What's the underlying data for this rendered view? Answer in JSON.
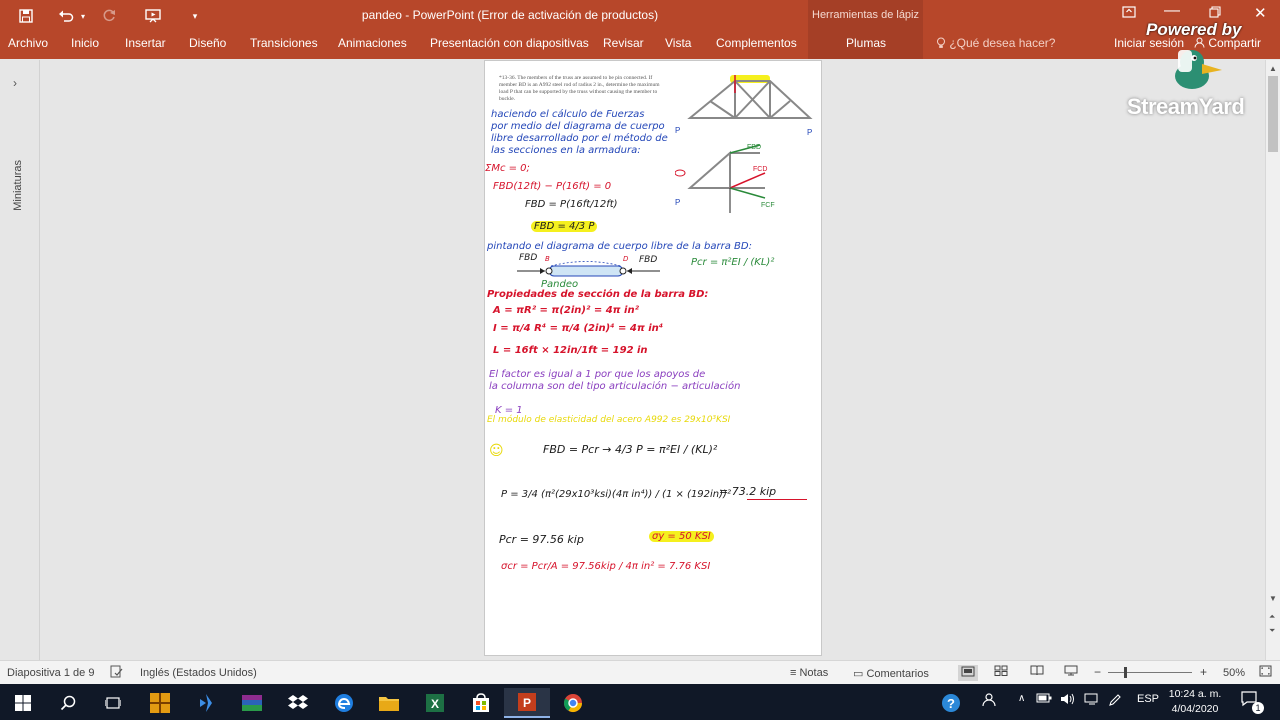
{
  "app": {
    "window_title": "pandeo - PowerPoint (Error de activación de productos)",
    "contextual_group": "Herramientas de lápiz"
  },
  "ribbon": {
    "tabs": [
      "Archivo",
      "Inicio",
      "Insertar",
      "Diseño",
      "Transiciones",
      "Animaciones",
      "Presentación con diapositivas",
      "Revisar",
      "Vista",
      "Complementos",
      "Plumas"
    ],
    "tell_me": "¿Qué desea hacer?",
    "sign_in": "Iniciar sesión",
    "share": "Compartir"
  },
  "thumbnails_pane": {
    "label": "Miniaturas"
  },
  "slide": {
    "problem_text": "*13-36. The members of the truss are assumed to be pin connected. If member BD is an A992 steel rod of radius 2 in., determine the maximum load P that can be supported by the truss without causing the member to buckle.",
    "notes": {
      "l1": "haciendo el cálculo de Fuerzas",
      "l2": "por medio del diagrama de cuerpo",
      "l3": "libre desarrollado por el método de",
      "l4": "las secciones en la armadura:",
      "sum_moments": "ΣMc = 0;",
      "eq1": "FBD(12ft) − P(16ft) = 0",
      "eq2": "FBD = P(16ft/12ft)",
      "eq3": "FBD = 4/3 P",
      "fbd_title": "pintando el diagrama de cuerpo libre de la barra BD:",
      "fbd_left": "FBD",
      "fbd_right": "FBD",
      "fbd_b": "B",
      "fbd_d": "D",
      "pandeo": "Pandeo",
      "euler": "Pcr = π²EI / (KL)²",
      "props_title": "Propiedades de sección de la barra BD:",
      "area": "A = πR² = π(2in)² = 4π in²",
      "inertia": "I = π/4 R⁴ = π/4 (2in)⁴ = 4π in⁴",
      "length": "L = 16ft × 12in/1ft = 192 in",
      "k1": "El factor es igual a 1 por que los apoyos de",
      "k2": "la columna son del tipo articulación − articulación",
      "k3": "K = 1",
      "modulus": "El módulo de elasticidad del acero A992 es 29x10³KSI",
      "smile": "☺",
      "eq4": "FBD = Pcr → 4/3 P = π²EI / (KL)²",
      "eq5a": "P = 3/4 (π²(29x10³ksi)(4π in⁴)) / (1 × (192in))²",
      "eq5b": "= 73.2 kip",
      "pcr": "Pcr = 97.56 kip",
      "sigma_y": "σy = 50 KSI",
      "sigma_cr": "σcr = Pcr/A = 97.56kip / 4π in² = 7.76 KSI"
    },
    "diagram": {
      "p_left": "P",
      "p_right": "P",
      "fbd_label": "FBD",
      "fcd_label": "FCD",
      "fcf_label": "FCF",
      "p_bottom": "P"
    }
  },
  "statusbar": {
    "slide_info": "Diapositiva 1 de 9",
    "language": "Inglés (Estados Unidos)",
    "notes": "Notas",
    "comments": "Comentarios",
    "zoom": "50%"
  },
  "taskbar": {
    "language": "ESP",
    "time": "10:24 a. m.",
    "date": "4/04/2020",
    "notification_count": "1"
  },
  "overlay": {
    "powered": "Powered by",
    "brand": "StreamYard"
  },
  "colors": {
    "powerpoint_accent": "#b7472a",
    "ink_blue": "#2447b8",
    "ink_red": "#d6132b",
    "ink_purple": "#8a3fbf",
    "ink_yellow": "#e8d90a",
    "highlight": "#f5f01e"
  }
}
